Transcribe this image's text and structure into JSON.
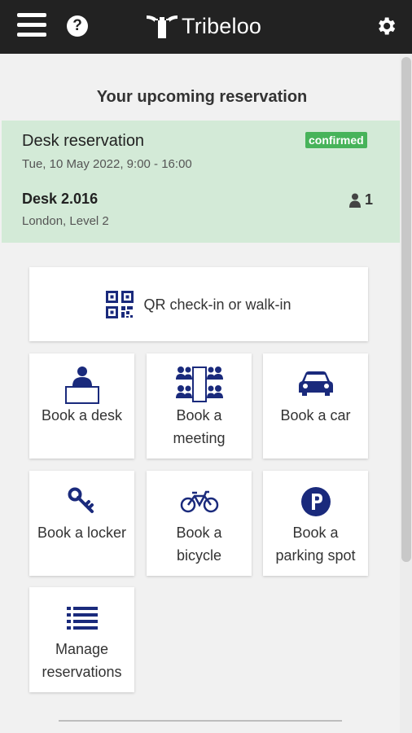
{
  "app": {
    "name": "Tribeloo"
  },
  "header": {
    "menu_icon": "menu-icon",
    "help_icon": "help-icon",
    "help_glyph": "?",
    "settings_icon": "gear-icon"
  },
  "upcoming": {
    "title": "Your upcoming reservation",
    "reservation": {
      "type": "Desk reservation",
      "status": "confirmed",
      "datetime": "Tue, 10 May 2022, 9:00 - 16:00",
      "resource": "Desk 2.016",
      "location": "London, Level 2",
      "attendees": "1"
    }
  },
  "actions": {
    "qr": {
      "label": "QR check-in or walk-in",
      "icon": "qr-code-icon"
    },
    "tiles": [
      {
        "label": "Book a desk",
        "icon": "desk-icon"
      },
      {
        "label": "Book a meeting",
        "icon": "meeting-room-icon"
      },
      {
        "label": "Book a car",
        "icon": "car-icon"
      },
      {
        "label": "Book a locker",
        "icon": "key-icon"
      },
      {
        "label": "Book a bicycle",
        "icon": "bicycle-icon"
      },
      {
        "label": "Book a parking spot",
        "icon": "parking-icon"
      },
      {
        "label": "Manage reservations",
        "icon": "list-icon"
      }
    ]
  },
  "colors": {
    "header_bg": "#222222",
    "reservation_bg": "#d3ead7",
    "badge_green": "#47b35a",
    "icon_navy": "#1a2a7c"
  }
}
